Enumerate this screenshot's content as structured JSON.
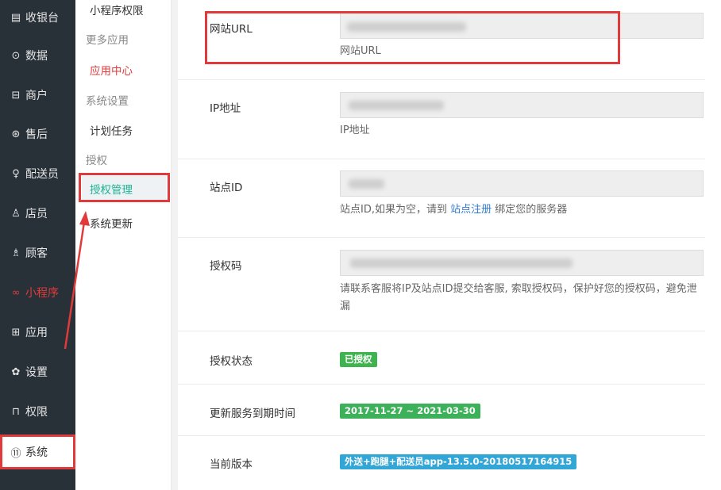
{
  "sidebar": {
    "items": [
      {
        "label": "收银台",
        "icon": "▤"
      },
      {
        "label": "数据",
        "icon": "⊙"
      },
      {
        "label": "商户",
        "icon": "⊟"
      },
      {
        "label": "售后",
        "icon": "⊛"
      },
      {
        "label": "配送员",
        "icon": "♀"
      },
      {
        "label": "店员",
        "icon": "♙"
      },
      {
        "label": "顾客",
        "icon": "♗"
      },
      {
        "label": "小程序",
        "icon": "∞"
      },
      {
        "label": "应用",
        "icon": "⊞"
      },
      {
        "label": "设置",
        "icon": "✿"
      },
      {
        "label": "权限",
        "icon": "⊓"
      },
      {
        "label": "系统",
        "icon": "⑪"
      }
    ]
  },
  "submenu": {
    "items": [
      {
        "label": "小程序权限"
      },
      {
        "label": "更多应用"
      },
      {
        "label": "应用中心"
      },
      {
        "label": "系统设置"
      },
      {
        "label": "计划任务"
      },
      {
        "label": "授权"
      },
      {
        "label": "授权管理"
      },
      {
        "label": "系统更新"
      }
    ]
  },
  "form": {
    "site_url": {
      "label": "网站URL",
      "hint": "网站URL"
    },
    "ip": {
      "label": "IP地址",
      "hint": "IP地址"
    },
    "site_id": {
      "label": "站点ID",
      "hint_before": "站点ID,如果为空，请到 ",
      "hint_link": "站点注册",
      "hint_after": " 绑定您的服务器"
    },
    "auth_code": {
      "label": "授权码",
      "hint": "请联系客服将IP及站点ID提交给客服, 索取授权码，保护好您的授权码，避免泄漏"
    },
    "auth_status": {
      "label": "授权状态",
      "badge": "已授权"
    },
    "service_expiry": {
      "label": "更新服务到期时间",
      "badge": "2017-11-27 ~ 2021-03-30"
    },
    "current_version": {
      "label": "当前版本",
      "badge": "外送+跑腿+配送员app-13.5.0-20180517164915"
    }
  },
  "colors": {
    "sidebar_bg": "#283038",
    "accent_green": "#1ab394",
    "highlight_red": "#e03a3a",
    "badge_green": "#3fb34f",
    "badge_blue": "#33a6d8"
  }
}
